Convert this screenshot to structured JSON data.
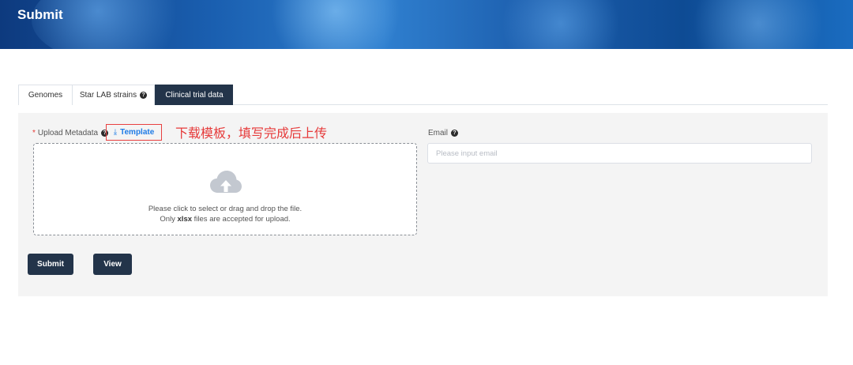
{
  "header": {
    "title": "Submit"
  },
  "tabs": [
    {
      "label": "Genomes",
      "active": false
    },
    {
      "label": "Star LAB strains",
      "active": false,
      "help_icon": "question-circle-icon"
    },
    {
      "label": "Clinical trial data",
      "active": true
    }
  ],
  "form": {
    "upload": {
      "required_mark": "*",
      "label": "Upload Metadata",
      "help_icon": "question-circle-icon",
      "template_icon": "download-icon",
      "template_link": "Template",
      "annotation": "下载模板，填写完成后上传",
      "dropzone_icon": "cloud-upload-icon",
      "hint_line1": "Please click to select or drag and drop the file.",
      "hint_line2_prefix": "Only",
      "hint_line2_format": "xlsx",
      "hint_line2_suffix": "files are accepted for upload."
    },
    "email": {
      "label": "Email",
      "help_icon": "question-circle-icon",
      "value": "",
      "placeholder": "Please input email"
    }
  },
  "actions": {
    "submit_label": "Submit",
    "view_label": "View"
  },
  "colors": {
    "accent_dark": "#23344a",
    "link_blue": "#1e7be6",
    "annotation_red": "#e63a3a",
    "panel_bg": "#f4f4f4"
  }
}
